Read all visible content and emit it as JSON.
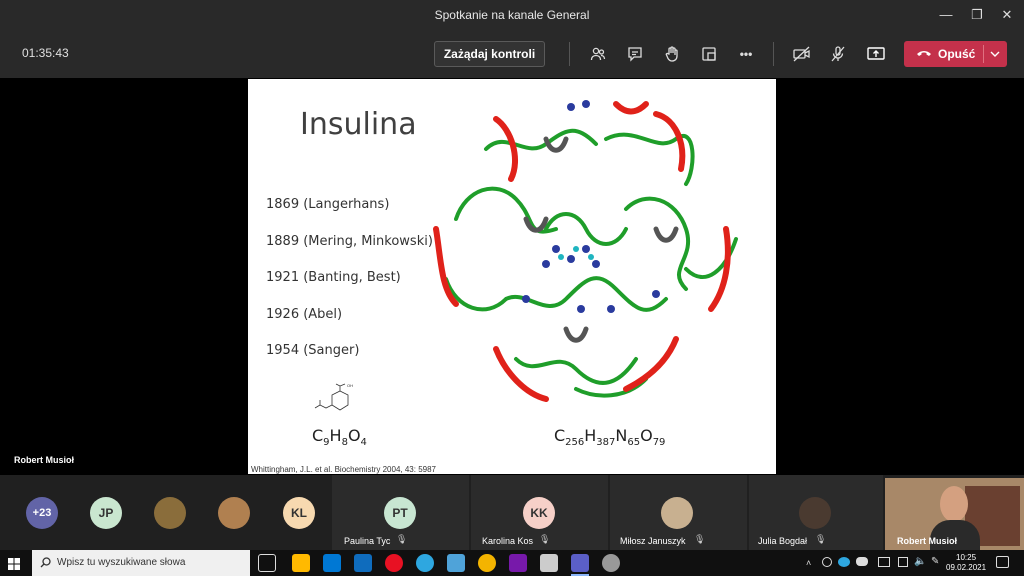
{
  "window": {
    "title": "Spotkanie na kanale General",
    "minimize_glyph": "—",
    "maximize_glyph": "❐",
    "close_glyph": "✕"
  },
  "callbar": {
    "timer": "01:35:43",
    "take_control_label": "Zażądaj kontroli",
    "more_glyph": "•••",
    "leave_label": "Opuść",
    "leave_color": "#c4314b",
    "icons": [
      "participants-icon",
      "chat-icon",
      "raise-hand-icon",
      "rooms-icon",
      "more-icon",
      "camera-off-icon",
      "mic-off-icon",
      "share-icon",
      "phone-icon",
      "chevron-down-icon"
    ]
  },
  "stage": {
    "presenter_name": "Robert Musioł"
  },
  "slide": {
    "title": "Insulina",
    "timeline": [
      "1869 (Langerhans)",
      "1889 (Mering, Minkowski)",
      "1921 (Banting, Best)",
      "1926 (Abel)",
      "1954 (Sanger)"
    ],
    "aspirin_formula": {
      "c": "C",
      "c_n": "9",
      "h": "H",
      "h_n": "8",
      "o": "O",
      "o_n": "4"
    },
    "insulin_formula": {
      "c": "C",
      "c_n": "256",
      "h": "H",
      "h_n": "387",
      "n": "N",
      "n_n": "65",
      "o": "O",
      "o_n": "79"
    },
    "aspirin_oh_label": "OH",
    "citation": "Whittingham, J.L. et al. Biochemistry 2004, 43: 5987"
  },
  "participants": {
    "overflow_count": "+23",
    "small": [
      {
        "initials": "JP",
        "color": "#c9e6cf"
      },
      {
        "initials": "",
        "color": "#8a6d3b",
        "photo": true
      },
      {
        "initials": "",
        "color": "#b08050",
        "photo": true
      },
      {
        "initials": "KL",
        "color": "#f7d9b0"
      }
    ],
    "tiles": [
      {
        "name": "Paulina Tyc",
        "initials": "PT",
        "color": "#c8e6d2"
      },
      {
        "name": "Karolina Kos",
        "initials": "KK",
        "color": "#f6d0c8"
      },
      {
        "name": "Miłosz Januszyk",
        "initials": "",
        "color": "#c8b090",
        "photo": true
      },
      {
        "name": "Julia Bogdał",
        "initials": "",
        "color": "#4a3a30",
        "photo": true
      }
    ],
    "self_view_name": "Robert Musioł"
  },
  "taskbar": {
    "search_placeholder": "Wpisz tu wyszukiwane słowa",
    "time": "10:25",
    "date": "09.02.2021"
  }
}
